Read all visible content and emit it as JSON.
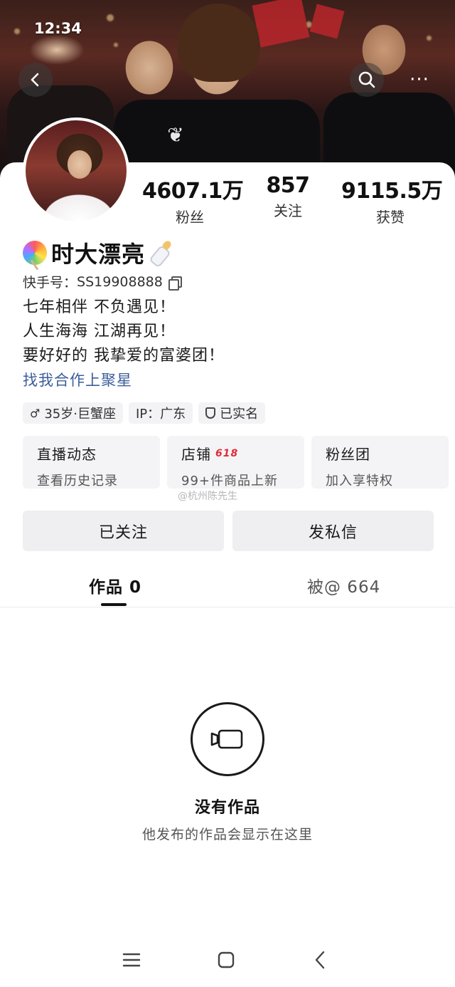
{
  "status_bar": {
    "time": "12:34"
  },
  "header": {
    "back_icon": "chevron-left-icon",
    "search_icon": "search-icon",
    "more_icon": "more-dots-icon",
    "more_label": "···"
  },
  "profile": {
    "name": "时大漂亮",
    "name_prefix_emoji": "lollipop-emoji",
    "name_suffix_emoji": "baby-bottle-emoji",
    "uid_label": "快手号：",
    "uid_value": "SS19908888",
    "bio_lines": [
      "七年相伴 不负遇见！",
      "人生海海 江湖再见！",
      "要好好的 我挚爱的富婆团！"
    ],
    "bio_link": "找我合作上聚星"
  },
  "stats": {
    "fans": {
      "value": "4607.1万",
      "label": "粉丝"
    },
    "following": {
      "value": "857",
      "label": "关注"
    },
    "likes": {
      "value": "9115.5万",
      "label": "获赞"
    }
  },
  "tags": {
    "gender_icon": "♂",
    "age_sign": "35岁·巨蟹座",
    "ip": "IP：广东",
    "verified": "已实名"
  },
  "tiles": [
    {
      "title": "直播动态",
      "subtitle": "查看历史记录"
    },
    {
      "title": "店铺",
      "badge": "618",
      "subtitle": "99+件商品上新"
    },
    {
      "title": "粉丝团",
      "subtitle": "加入享特权"
    }
  ],
  "watermark": "@杭州陈先生",
  "actions": {
    "followed": "已关注",
    "message": "发私信"
  },
  "tabs": {
    "works": "作品 0",
    "mentioned": "被@ 664"
  },
  "empty_state": {
    "icon": "video-camera-icon",
    "title": "没有作品",
    "subtitle": "他发布的作品会显示在这里"
  },
  "nav": {
    "menu_icon": "menu-icon",
    "home_icon": "home-square-icon",
    "back_icon": "back-triangle-icon"
  }
}
